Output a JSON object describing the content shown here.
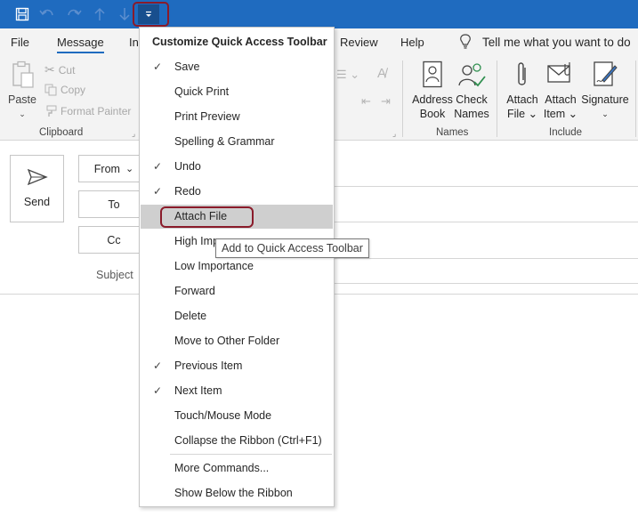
{
  "qat": {
    "icons": [
      "save-icon",
      "undo-icon",
      "redo-icon",
      "previous-item-icon",
      "next-item-icon",
      "customize-qat-icon"
    ]
  },
  "tabs": {
    "file": "File",
    "message": "Message",
    "insert": "In",
    "review": "Review",
    "help": "Help",
    "tell_me": "Tell me what you want to do"
  },
  "ribbon": {
    "clipboard": {
      "paste": "Paste",
      "cut": "Cut",
      "copy": "Copy",
      "format_painter": "Format Painter",
      "label": "Clipboard"
    },
    "names": {
      "address_book_1": "Address",
      "address_book_2": "Book",
      "check_names_1": "Check",
      "check_names_2": "Names",
      "label": "Names"
    },
    "include": {
      "attach_file_1": "Attach",
      "attach_file_2": "File",
      "attach_item_1": "Attach",
      "attach_item_2": "Item",
      "signature": "Signature",
      "label": "Include"
    }
  },
  "compose": {
    "send": "Send",
    "from": "From",
    "to": "To",
    "cc": "Cc",
    "subject": "Subject"
  },
  "menu": {
    "title": "Customize Quick Access Toolbar",
    "items": [
      {
        "label": "Save",
        "checked": true
      },
      {
        "label": "Quick Print",
        "checked": false
      },
      {
        "label": "Print Preview",
        "checked": false
      },
      {
        "label": "Spelling & Grammar",
        "checked": false
      },
      {
        "label": "Undo",
        "checked": true
      },
      {
        "label": "Redo",
        "checked": true
      },
      {
        "label": "Attach File",
        "checked": false
      },
      {
        "label": "High Imp",
        "checked": false
      },
      {
        "label": "Low Importance",
        "checked": false
      },
      {
        "label": "Forward",
        "checked": false
      },
      {
        "label": "Delete",
        "checked": false
      },
      {
        "label": "Move to Other Folder",
        "checked": false
      },
      {
        "label": "Previous Item",
        "checked": true
      },
      {
        "label": "Next Item",
        "checked": true
      },
      {
        "label": "Touch/Mouse Mode",
        "checked": false
      },
      {
        "label": "Collapse the Ribbon (Ctrl+F1)",
        "checked": false
      },
      {
        "label": "More Commands...",
        "checked": false
      },
      {
        "label": "Show Below the Ribbon",
        "checked": false
      }
    ],
    "check_glyph": "✓"
  },
  "tooltip": "Add to Quick Access Toolbar",
  "colors": {
    "title_bar": "#1f6bbf",
    "highlight_outline": "#8a1b2a",
    "hover_item": "#cfcfcf"
  }
}
